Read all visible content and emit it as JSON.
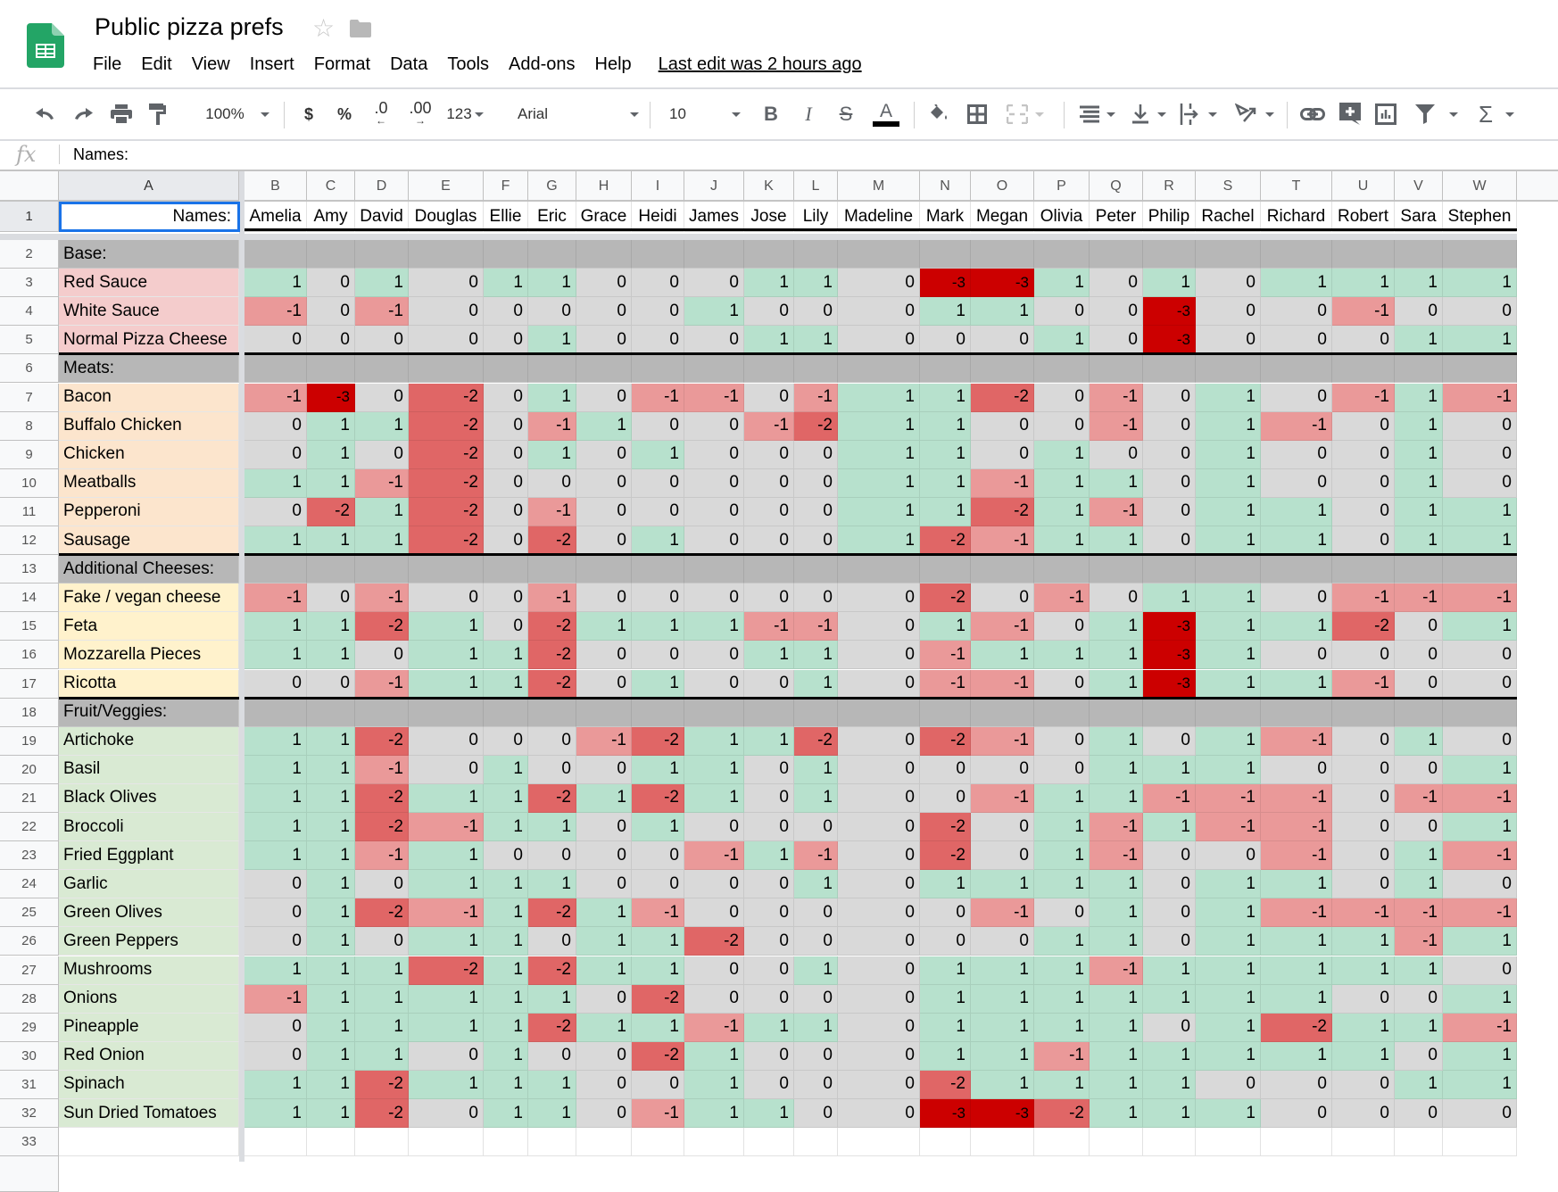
{
  "app": {
    "title": "Public pizza prefs",
    "menu": [
      "File",
      "Edit",
      "View",
      "Insert",
      "Format",
      "Data",
      "Tools",
      "Add-ons",
      "Help"
    ],
    "last_edit": "Last edit was 2 hours ago"
  },
  "toolbar": {
    "zoom": "100%",
    "currency": "$",
    "percent": "%",
    "decrease_decimal": ".0",
    "increase_decimal": ".00",
    "more_formats": "123",
    "font": "Arial",
    "font_size": "10",
    "bold": "B",
    "italic": "I",
    "strike": "S",
    "text_color": "A",
    "sum": "Σ",
    "icons": [
      "undo-icon",
      "redo-icon",
      "print-icon",
      "paint-format-icon",
      "fill-color-icon",
      "borders-icon",
      "merge-cells-icon",
      "horizontal-align-icon",
      "vertical-align-icon",
      "text-wrap-icon",
      "text-rotation-icon",
      "link-icon",
      "comment-icon",
      "chart-icon",
      "filter-icon",
      "functions-icon"
    ]
  },
  "formula_bar": {
    "fx": "fx",
    "content": "Names:"
  },
  "sheet": {
    "active_cell": "A1",
    "columns": [
      "A",
      "B",
      "C",
      "D",
      "E",
      "F",
      "G",
      "H",
      "I",
      "J",
      "K",
      "L",
      "M",
      "N",
      "O",
      "P",
      "Q",
      "R",
      "S",
      "T",
      "U",
      "V",
      "W"
    ],
    "header_label": "Names:",
    "names": [
      "Amelia",
      "Amy",
      "David",
      "Douglas",
      "Ellie",
      "Eric",
      "Grace",
      "Heidi",
      "James",
      "Jose",
      "Lily",
      "Madeline",
      "Mark",
      "Megan",
      "Olivia",
      "Peter",
      "Philip",
      "Rachel",
      "Richard",
      "Robert",
      "Sara",
      "Stephen"
    ],
    "colors": {
      "score": {
        "-3": "#cc0000",
        "-2": "#e06666",
        "-1": "#ea9999",
        "0": "#d9d9d9",
        "1": "#b7e1cd"
      },
      "section_header": "#b7b7b7",
      "group_fill": {
        "base": "#f4cccc",
        "meats": "#fce5cd",
        "cheeses": "#fff2cc",
        "veggies": "#d9ead3"
      }
    },
    "rows": [
      {
        "row": 2,
        "type": "section",
        "label": "Base:"
      },
      {
        "row": 3,
        "type": "item",
        "group": "base",
        "label": "Red Sauce",
        "values": [
          1,
          0,
          1,
          0,
          1,
          1,
          0,
          0,
          0,
          1,
          1,
          0,
          -3,
          -3,
          1,
          0,
          1,
          0,
          1,
          1,
          1,
          1
        ]
      },
      {
        "row": 4,
        "type": "item",
        "group": "base",
        "label": "White Sauce",
        "values": [
          -1,
          0,
          -1,
          0,
          0,
          0,
          0,
          0,
          1,
          0,
          0,
          0,
          1,
          1,
          0,
          0,
          -3,
          0,
          0,
          -1,
          0,
          0
        ]
      },
      {
        "row": 5,
        "type": "item",
        "group": "base",
        "label": "Normal Pizza Cheese",
        "values": [
          0,
          0,
          0,
          0,
          0,
          1,
          0,
          0,
          0,
          1,
          1,
          0,
          0,
          0,
          1,
          0,
          -3,
          0,
          0,
          0,
          1,
          1
        ]
      },
      {
        "row": 6,
        "type": "section",
        "label": "Meats:"
      },
      {
        "row": 7,
        "type": "item",
        "group": "meats",
        "label": "Bacon",
        "values": [
          -1,
          -3,
          0,
          -2,
          0,
          1,
          0,
          -1,
          -1,
          0,
          -1,
          1,
          1,
          -2,
          0,
          -1,
          0,
          1,
          0,
          -1,
          1,
          -1
        ]
      },
      {
        "row": 8,
        "type": "item",
        "group": "meats",
        "label": "Buffalo Chicken",
        "values": [
          0,
          1,
          1,
          -2,
          0,
          -1,
          1,
          0,
          0,
          -1,
          -2,
          1,
          1,
          0,
          0,
          -1,
          0,
          1,
          -1,
          0,
          1,
          0
        ]
      },
      {
        "row": 9,
        "type": "item",
        "group": "meats",
        "label": "Chicken",
        "values": [
          0,
          1,
          0,
          -2,
          0,
          1,
          0,
          1,
          0,
          0,
          0,
          1,
          1,
          0,
          1,
          0,
          0,
          1,
          0,
          0,
          1,
          0
        ]
      },
      {
        "row": 10,
        "type": "item",
        "group": "meats",
        "label": "Meatballs",
        "values": [
          1,
          1,
          -1,
          -2,
          0,
          0,
          0,
          0,
          0,
          0,
          0,
          1,
          1,
          -1,
          1,
          1,
          0,
          1,
          0,
          0,
          1,
          0
        ]
      },
      {
        "row": 11,
        "type": "item",
        "group": "meats",
        "label": "Pepperoni",
        "values": [
          0,
          -2,
          1,
          -2,
          0,
          -1,
          0,
          0,
          0,
          0,
          0,
          1,
          1,
          -2,
          1,
          -1,
          0,
          1,
          1,
          0,
          1,
          1
        ]
      },
      {
        "row": 12,
        "type": "item",
        "group": "meats",
        "label": "Sausage",
        "values": [
          1,
          1,
          1,
          -2,
          0,
          -2,
          0,
          1,
          0,
          0,
          0,
          1,
          -2,
          -1,
          1,
          1,
          0,
          1,
          1,
          0,
          1,
          1
        ]
      },
      {
        "row": 13,
        "type": "section",
        "label": "Additional Cheeses:"
      },
      {
        "row": 14,
        "type": "item",
        "group": "cheeses",
        "label": "Fake / vegan cheese",
        "values": [
          -1,
          0,
          -1,
          0,
          0,
          -1,
          0,
          0,
          0,
          0,
          0,
          0,
          -2,
          0,
          -1,
          0,
          1,
          1,
          0,
          -1,
          -1,
          -1
        ]
      },
      {
        "row": 15,
        "type": "item",
        "group": "cheeses",
        "label": "Feta",
        "values": [
          1,
          1,
          -2,
          1,
          0,
          -2,
          1,
          1,
          1,
          -1,
          -1,
          0,
          1,
          -1,
          0,
          1,
          -3,
          1,
          1,
          -2,
          0,
          1
        ]
      },
      {
        "row": 16,
        "type": "item",
        "group": "cheeses",
        "label": "Mozzarella Pieces",
        "values": [
          1,
          1,
          0,
          1,
          1,
          -2,
          0,
          0,
          0,
          1,
          1,
          0,
          -1,
          1,
          1,
          1,
          -3,
          1,
          0,
          0,
          0,
          0
        ]
      },
      {
        "row": 17,
        "type": "item",
        "group": "cheeses",
        "label": "Ricotta",
        "values": [
          0,
          0,
          -1,
          1,
          1,
          -2,
          0,
          1,
          0,
          0,
          1,
          0,
          -1,
          -1,
          0,
          1,
          -3,
          1,
          1,
          -1,
          0,
          0
        ]
      },
      {
        "row": 18,
        "type": "section",
        "label": "Fruit/Veggies:"
      },
      {
        "row": 19,
        "type": "item",
        "group": "veggies",
        "label": "Artichoke",
        "values": [
          1,
          1,
          -2,
          0,
          0,
          0,
          -1,
          -2,
          1,
          1,
          -2,
          0,
          -2,
          -1,
          0,
          1,
          0,
          1,
          -1,
          0,
          1,
          0
        ]
      },
      {
        "row": 20,
        "type": "item",
        "group": "veggies",
        "label": "Basil",
        "values": [
          1,
          1,
          -1,
          0,
          1,
          0,
          0,
          1,
          1,
          0,
          1,
          0,
          0,
          0,
          0,
          1,
          1,
          1,
          0,
          0,
          0,
          1
        ]
      },
      {
        "row": 21,
        "type": "item",
        "group": "veggies",
        "label": "Black Olives",
        "values": [
          1,
          1,
          -2,
          1,
          1,
          -2,
          1,
          -2,
          1,
          0,
          1,
          0,
          0,
          -1,
          1,
          1,
          -1,
          -1,
          -1,
          0,
          -1,
          -1
        ]
      },
      {
        "row": 22,
        "type": "item",
        "group": "veggies",
        "label": "Broccoli",
        "values": [
          1,
          1,
          -2,
          -1,
          1,
          1,
          0,
          1,
          0,
          0,
          0,
          0,
          -2,
          0,
          1,
          -1,
          1,
          -1,
          -1,
          0,
          0,
          1
        ]
      },
      {
        "row": 23,
        "type": "item",
        "group": "veggies",
        "label": "Fried Eggplant",
        "values": [
          1,
          1,
          -1,
          1,
          0,
          0,
          0,
          0,
          -1,
          1,
          -1,
          0,
          -2,
          0,
          1,
          -1,
          0,
          0,
          -1,
          0,
          1,
          -1
        ]
      },
      {
        "row": 24,
        "type": "item",
        "group": "veggies",
        "label": "Garlic",
        "values": [
          0,
          1,
          0,
          1,
          1,
          1,
          0,
          0,
          0,
          0,
          1,
          0,
          1,
          1,
          1,
          1,
          0,
          1,
          1,
          0,
          1,
          0
        ]
      },
      {
        "row": 25,
        "type": "item",
        "group": "veggies",
        "label": "Green Olives",
        "values": [
          0,
          1,
          -2,
          -1,
          1,
          -2,
          1,
          -1,
          0,
          0,
          0,
          0,
          0,
          -1,
          0,
          1,
          0,
          1,
          -1,
          -1,
          -1,
          -1
        ]
      },
      {
        "row": 26,
        "type": "item",
        "group": "veggies",
        "label": "Green Peppers",
        "values": [
          0,
          1,
          0,
          1,
          1,
          0,
          1,
          1,
          -2,
          0,
          0,
          0,
          0,
          0,
          1,
          1,
          0,
          1,
          1,
          1,
          -1,
          1
        ]
      },
      {
        "row": 27,
        "type": "item",
        "group": "veggies",
        "label": "Mushrooms",
        "values": [
          1,
          1,
          1,
          -2,
          1,
          -2,
          1,
          1,
          0,
          0,
          1,
          0,
          1,
          1,
          1,
          -1,
          1,
          1,
          1,
          1,
          1,
          0
        ]
      },
      {
        "row": 28,
        "type": "item",
        "group": "veggies",
        "label": "Onions",
        "values": [
          -1,
          1,
          1,
          1,
          1,
          1,
          0,
          -2,
          0,
          0,
          0,
          0,
          1,
          1,
          1,
          1,
          1,
          1,
          1,
          0,
          0,
          1
        ]
      },
      {
        "row": 29,
        "type": "item",
        "group": "veggies",
        "label": "Pineapple",
        "values": [
          0,
          1,
          1,
          1,
          1,
          -2,
          1,
          1,
          -1,
          1,
          1,
          0,
          1,
          1,
          1,
          1,
          0,
          1,
          -2,
          1,
          1,
          -1
        ]
      },
      {
        "row": 30,
        "type": "item",
        "group": "veggies",
        "label": "Red Onion",
        "values": [
          0,
          1,
          1,
          0,
          1,
          0,
          0,
          -2,
          1,
          0,
          0,
          0,
          1,
          1,
          -1,
          1,
          1,
          1,
          1,
          1,
          0,
          1
        ]
      },
      {
        "row": 31,
        "type": "item",
        "group": "veggies",
        "label": "Spinach",
        "values": [
          1,
          1,
          -2,
          1,
          1,
          1,
          0,
          0,
          1,
          0,
          0,
          0,
          -2,
          1,
          1,
          1,
          1,
          0,
          0,
          0,
          1,
          1
        ]
      },
      {
        "row": 32,
        "type": "item",
        "group": "veggies",
        "label": "Sun Dried Tomatoes",
        "values": [
          1,
          1,
          -2,
          0,
          1,
          1,
          0,
          -1,
          1,
          1,
          0,
          0,
          -3,
          -3,
          -2,
          1,
          1,
          1,
          0,
          0,
          0,
          0
        ]
      },
      {
        "row": 33,
        "type": "empty"
      }
    ]
  }
}
